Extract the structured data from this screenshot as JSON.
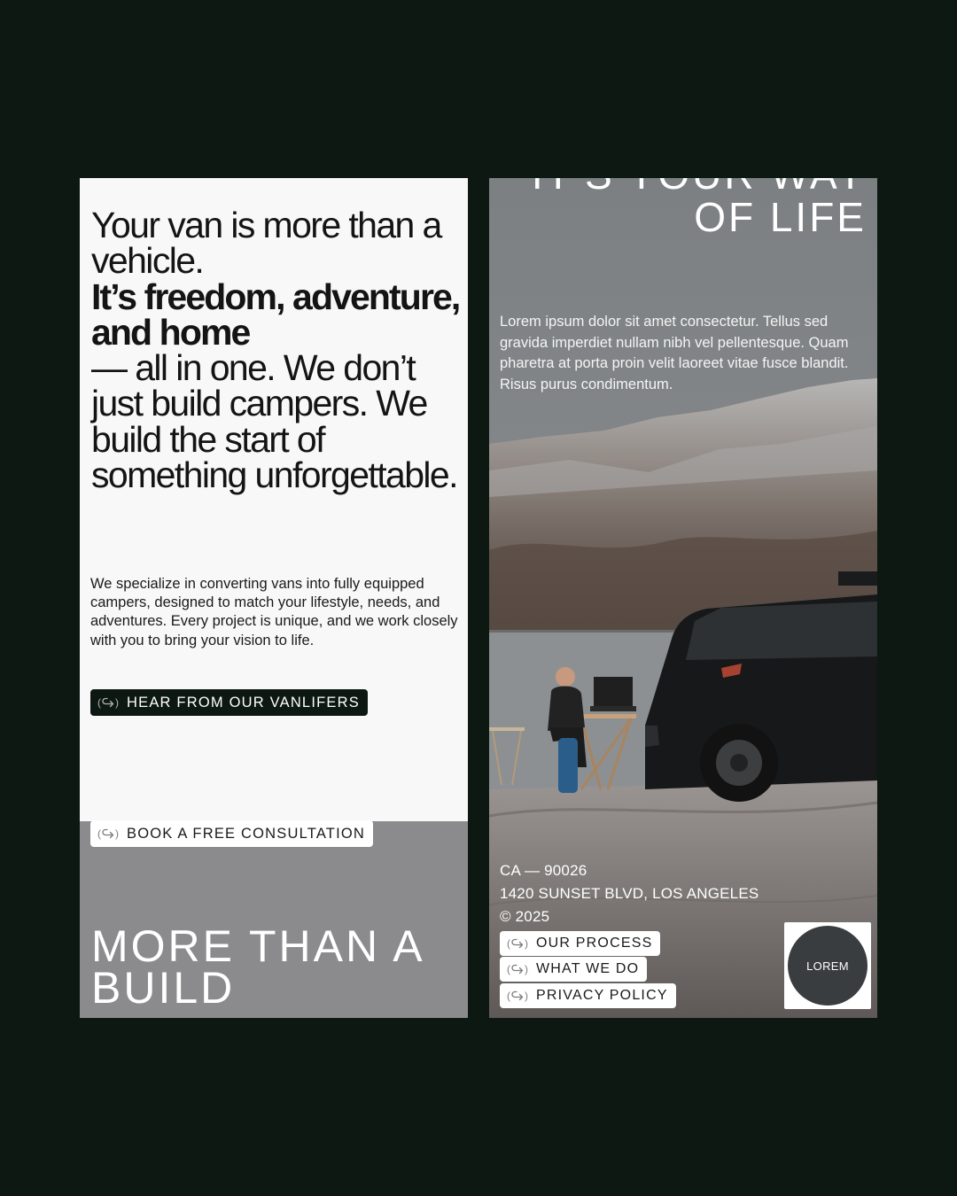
{
  "left_panel": {
    "headline": {
      "line1": "Your van is more than a vehicle.",
      "bold": "It’s freedom, adventure, and home",
      "line3": "— all in one. We don’t just build campers. We build the start of something unforgettable."
    },
    "body": "We specialize in converting vans into fully equipped campers, designed to match your lifestyle, needs, and adventures. Every project is unique, and we work closely with you to bring your vision to life.",
    "cta_vanlifers": "HEAR FROM OUR VANLIFERS",
    "cta_consultation": "BOOK A FREE CONSULTATION",
    "section_title": "MORE THAN A BUILD"
  },
  "right_panel": {
    "title_cut": "IT’S YOUR WAY",
    "title_visible": "OF LIFE",
    "body": "Lorem ipsum dolor sit amet consectetur. Tellus sed gravida imperdiet nullam nibh vel pellentesque. Quam pharetra at porta proin velit laoreet vitae fusce blandit. Risus purus condimentum.",
    "address": [
      "CA — 90026",
      "1420 SUNSET BLVD, LOS ANGELES",
      "© 2025"
    ],
    "links": [
      "OUR PROCESS",
      "WHAT WE DO",
      "PRIVACY POLICY"
    ],
    "badge": "LOREM"
  },
  "icons": {
    "pill_icon": "arrow-redirect-icon"
  },
  "colors": {
    "page_bg": "#0c1811",
    "panel_light": "#f8f8f8",
    "block_grey": "#8b8b8d",
    "dark_pill": "#0c1811"
  }
}
